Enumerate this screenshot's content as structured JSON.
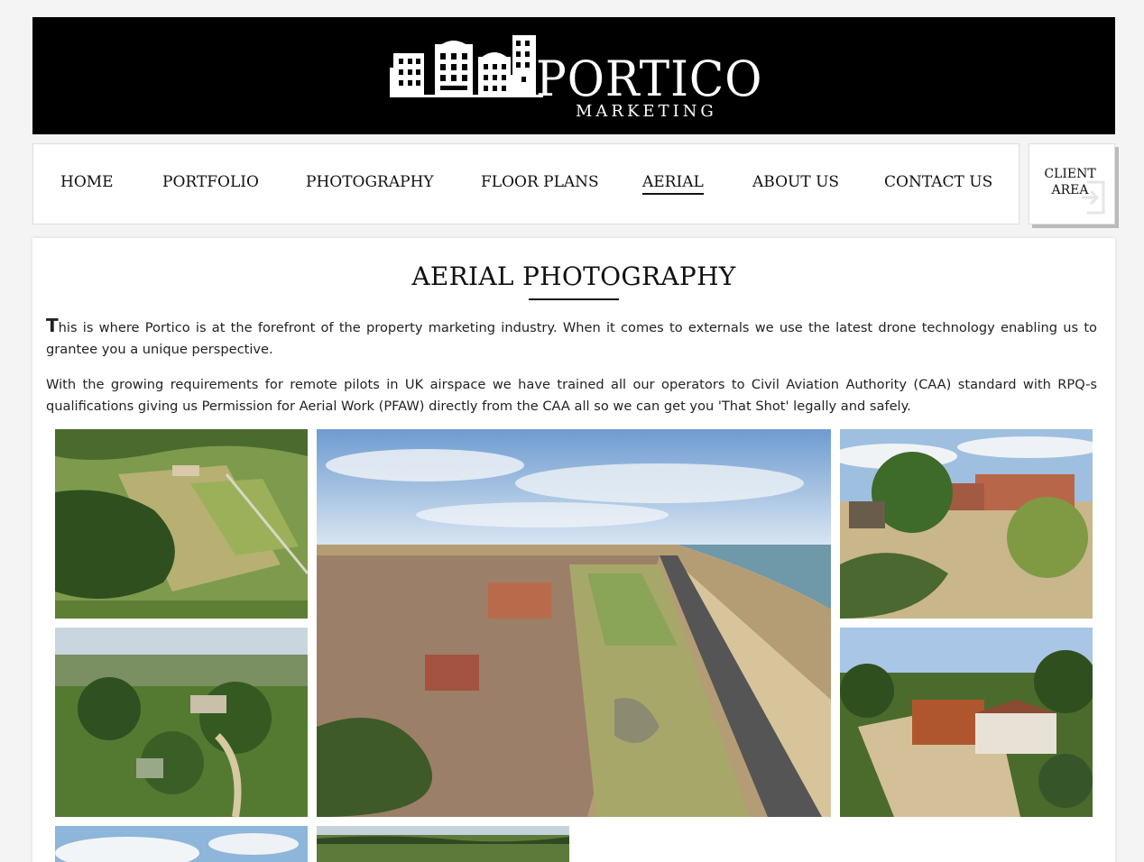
{
  "header": {
    "brand_title": "PORTICO",
    "brand_subtitle": "MARKETING"
  },
  "nav": {
    "items": [
      {
        "label": "HOME"
      },
      {
        "label": "PORTFOLIO"
      },
      {
        "label": "PHOTOGRAPHY"
      },
      {
        "label": "FLOOR PLANS"
      },
      {
        "label": "AERIAL",
        "active": true
      },
      {
        "label": "ABOUT US"
      },
      {
        "label": "CONTACT US"
      }
    ],
    "client_area_line1": "CLIENT",
    "client_area_line2": "AREA"
  },
  "page": {
    "title": "AERIAL PHOTOGRAPHY",
    "intro_dropcap": "T",
    "intro_rest": "his is where Portico is at the forefront of the property marketing industry. When it comes to externals we use the latest drone technology enabling us to grantee you a unique perspective.",
    "paragraph2": "With the growing requirements for remote pilots in UK airspace we have trained all our operators to Civil Aviation Authority (CAA) standard with RPQ-s qualifications giving us Permission for Aerial Work (PFAW) directly from the CAA all so we can get you 'That Shot' legally and safely."
  },
  "gallery": {
    "images": [
      {
        "name": "aerial-fields-photo"
      },
      {
        "name": "aerial-coastline-photo"
      },
      {
        "name": "aerial-buildings-photo"
      },
      {
        "name": "aerial-countryside-photo"
      },
      {
        "name": "aerial-house-photo"
      },
      {
        "name": "aerial-sky-photo"
      },
      {
        "name": "aerial-landscape-photo"
      }
    ]
  },
  "colors": {
    "header_bg": "#000000",
    "accent": "#111111"
  }
}
